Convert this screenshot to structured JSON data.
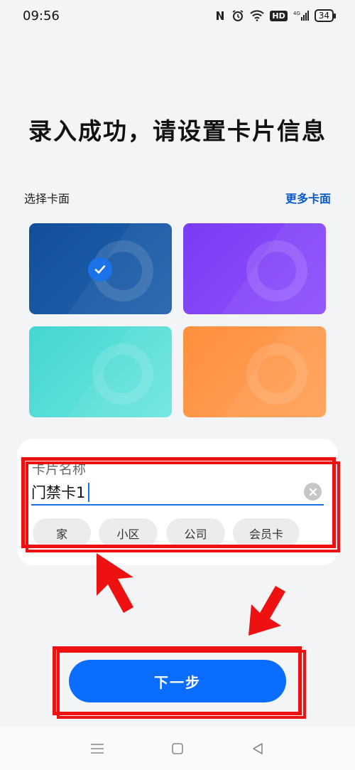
{
  "status": {
    "time": "09:56",
    "battery": "34",
    "hd": "HD",
    "network": "4G"
  },
  "page": {
    "title": "录入成功，请设置卡片信息"
  },
  "card_section": {
    "label": "选择卡面",
    "more_link": "更多卡面",
    "cards": [
      {
        "color": "#1a5aa6",
        "selected": true
      },
      {
        "color": "#8248f8",
        "selected": false
      },
      {
        "color": "#58dcd8",
        "selected": false
      },
      {
        "color": "#ff9a4e",
        "selected": false
      }
    ]
  },
  "form": {
    "label": "卡片名称",
    "value": "门禁卡1",
    "chips": [
      "家",
      "小区",
      "公司",
      "会员卡"
    ]
  },
  "next_button": {
    "label": "下一步"
  },
  "colors": {
    "accent": "#0a6dff",
    "highlight": "#ee1111",
    "link": "#0a59c8"
  }
}
